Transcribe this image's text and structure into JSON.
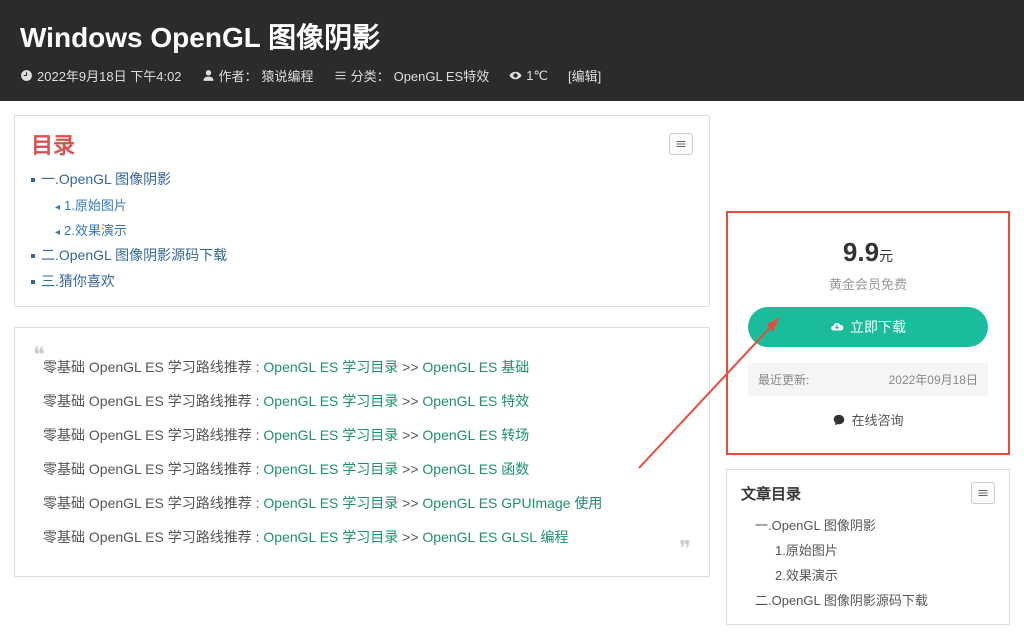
{
  "header": {
    "title": "Windows OpenGL 图像阴影",
    "date": "2022年9月18日 下午4:02",
    "author_label": "作者：",
    "author": "猿说编程",
    "category_label": "分类：",
    "category": "OpenGL ES特效",
    "views": "1℃",
    "edit": "[编辑]"
  },
  "toc": {
    "title": "目录",
    "items": [
      {
        "lvl": "lv1",
        "text": "一.OpenGL 图像阴影"
      },
      {
        "lvl": "lv2",
        "text": "1.原始图片"
      },
      {
        "lvl": "lv2",
        "text": "2.效果演示"
      },
      {
        "lvl": "lv1",
        "text": "二.OpenGL 图像阴影源码下载"
      },
      {
        "lvl": "lv1",
        "text": "三.猜你喜欢"
      }
    ]
  },
  "recs": {
    "prefix": "零基础 OpenGL ES 学习路线推荐 : ",
    "link1": "OpenGL ES 学习目录",
    "sep": " >> ",
    "items": [
      "OpenGL ES 基础",
      "OpenGL ES 特效",
      "OpenGL ES 转场",
      "OpenGL ES 函数",
      "OpenGL ES GPUImage 使用",
      "OpenGL ES GLSL 编程"
    ]
  },
  "price_box": {
    "price": "9.9",
    "unit": "元",
    "vip": "黄金会员免费",
    "download": "立即下载",
    "update_label": "最近更新:",
    "update_date": "2022年09月18日",
    "support": "在线咨询"
  },
  "side_toc": {
    "title": "文章目录",
    "items": [
      {
        "cls": "s1",
        "text": "一.OpenGL 图像阴影"
      },
      {
        "cls": "s2",
        "text": "1.原始图片"
      },
      {
        "cls": "s2",
        "text": "2.效果演示"
      },
      {
        "cls": "s1",
        "text": "二.OpenGL 图像阴影源码下载"
      }
    ]
  }
}
